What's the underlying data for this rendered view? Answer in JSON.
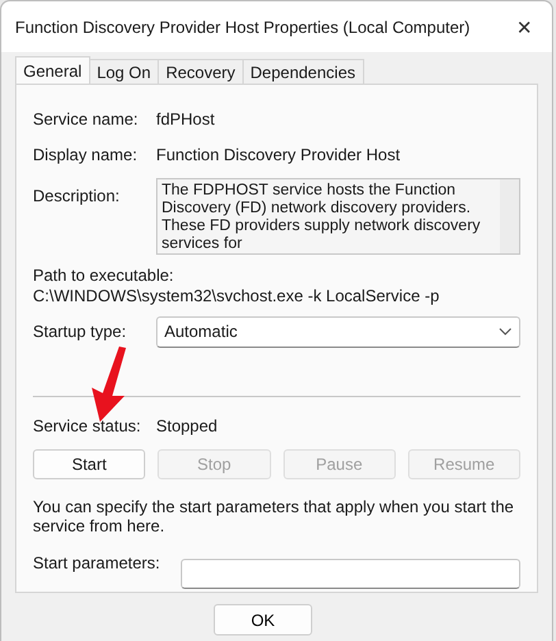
{
  "window": {
    "title": "Function Discovery Provider Host Properties (Local Computer)",
    "close": "✕"
  },
  "tabs": [
    {
      "label": "General",
      "selected": true
    },
    {
      "label": "Log On",
      "selected": false
    },
    {
      "label": "Recovery",
      "selected": false
    },
    {
      "label": "Dependencies",
      "selected": false
    }
  ],
  "service_name": {
    "label": "Service name:",
    "value": "fdPHost"
  },
  "display_name": {
    "label": "Display name:",
    "value": "Function Discovery Provider Host"
  },
  "description": {
    "label": "Description:",
    "value": "The FDPHOST service hosts the Function Discovery (FD) network discovery providers. These FD providers supply network discovery services for"
  },
  "path": {
    "label": "Path to executable:",
    "value": "C:\\WINDOWS\\system32\\svchost.exe -k LocalService -p"
  },
  "startup_type": {
    "label": "Startup type:",
    "value": "Automatic"
  },
  "service_status": {
    "label": "Service status:",
    "value": "Stopped"
  },
  "service_buttons": [
    {
      "label": "Start",
      "disabled": false
    },
    {
      "label": "Stop",
      "disabled": true
    },
    {
      "label": "Pause",
      "disabled": true
    },
    {
      "label": "Resume",
      "disabled": true
    }
  ],
  "hint": "You can specify the start parameters that apply when you start the service from here.",
  "start_parameters": {
    "label": "Start parameters:"
  },
  "dialog_buttons": [
    {
      "label": "OK"
    }
  ],
  "annotation": {
    "kind": "arrow"
  }
}
